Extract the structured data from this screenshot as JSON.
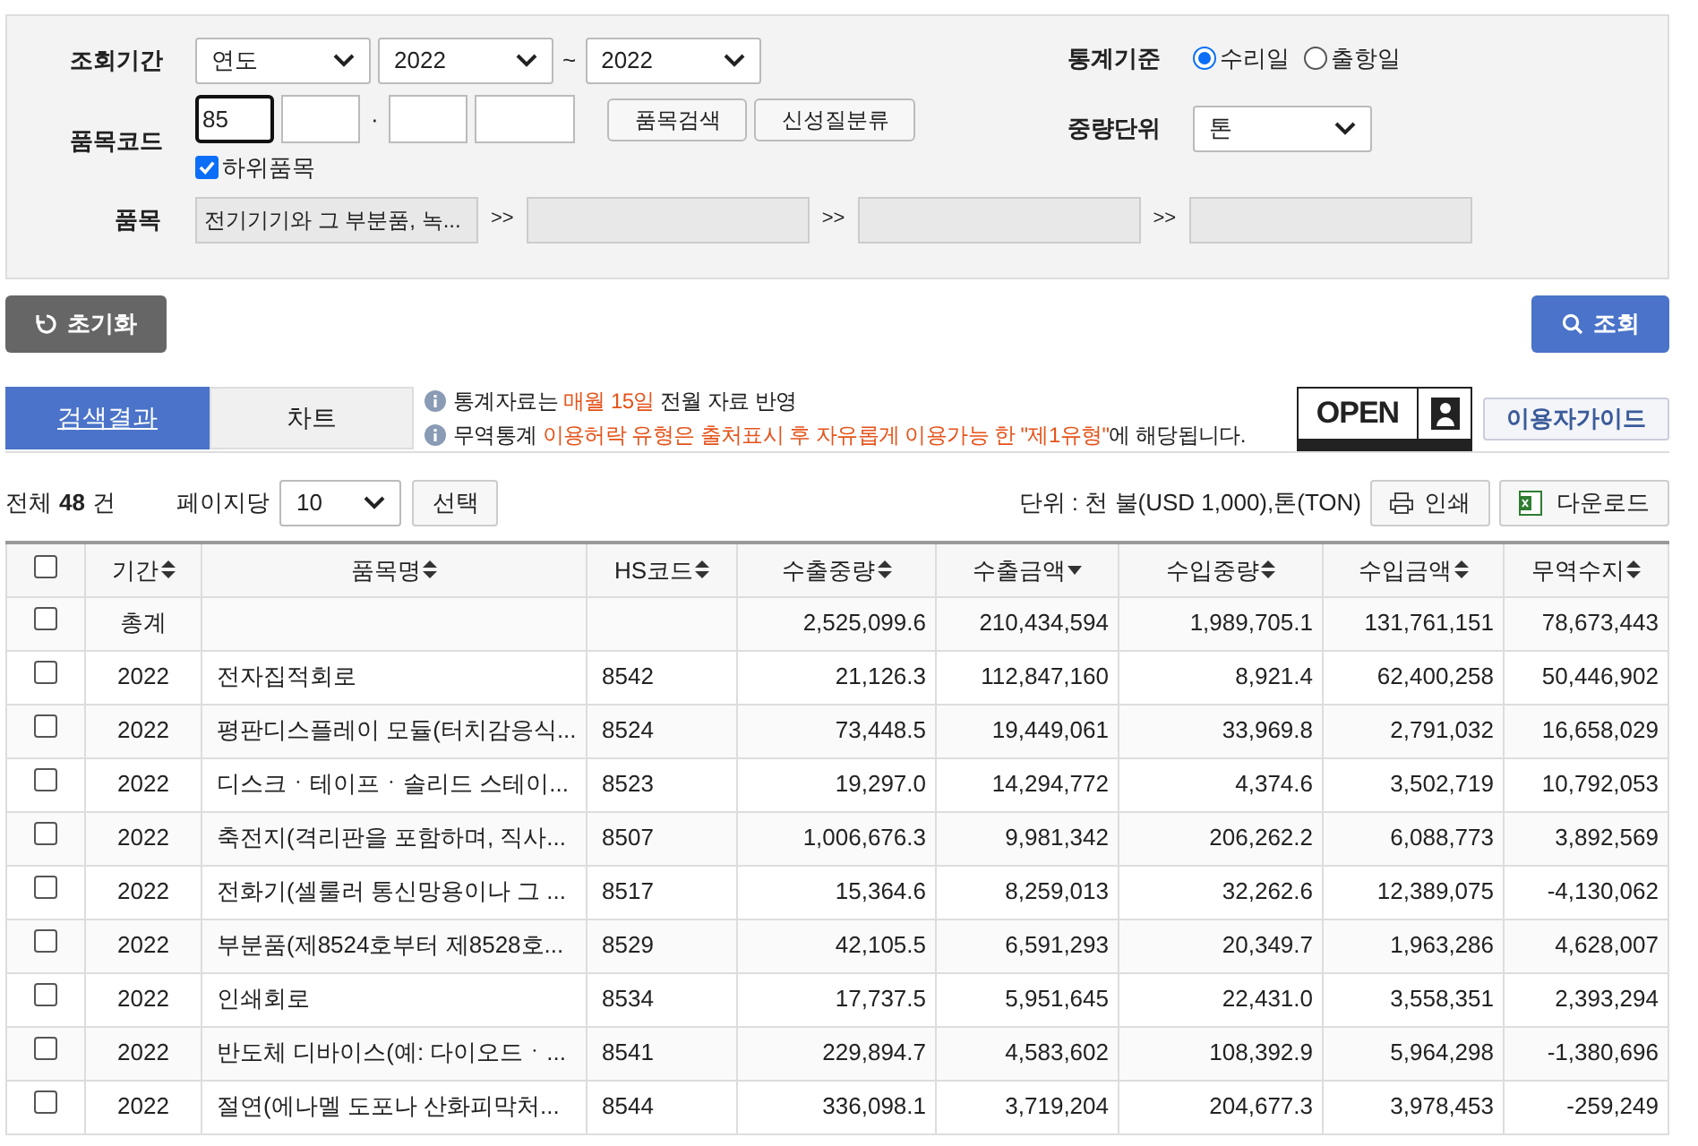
{
  "filter": {
    "period": {
      "label": "조회기간",
      "unit": "연도",
      "from": "2022",
      "range_sep": "~",
      "to": "2022"
    },
    "item_code": {
      "label": "품목코드",
      "fields": [
        {
          "value": "85",
          "focused": true
        },
        {
          "focused": false
        },
        {
          "focused": false
        },
        {
          "focused": false
        }
      ],
      "dot": "·",
      "buttons": [
        "품목검색",
        "신성질분류"
      ],
      "sub_items": {
        "label": "하위품목",
        "checked": true
      }
    },
    "item_path": {
      "label": "품목",
      "levels": [
        {
          "kind": "filled",
          "value": "전기기기와 그 부분품, 녹..."
        },
        {
          "kind": "empty"
        },
        {
          "kind": "empty"
        },
        {
          "kind": "empty"
        }
      ],
      "separators": [
        ">>",
        ">>",
        ">>"
      ]
    },
    "basis": {
      "label": "통계기준",
      "options": [
        {
          "label": "수리일",
          "selected": true
        },
        {
          "label": "출항일",
          "selected": false
        }
      ]
    },
    "weight_unit": {
      "label": "중량단위",
      "value": "톤"
    }
  },
  "reset_button": "초기화",
  "search_button": "조회",
  "tabs": [
    {
      "label": "검색결과",
      "selected": true
    },
    {
      "label": "차트",
      "selected": false
    }
  ],
  "notices": [
    [
      {
        "text": "통계자료는 "
      },
      {
        "text": "매월 15일",
        "highlight": true
      },
      {
        "text": " 전월 자료 반영"
      }
    ],
    [
      {
        "text": "무역통계 "
      },
      {
        "text": "이용허락 유형은 출처표시 후 자유롭게 이용가능 한 \"제1유형\"",
        "highlight": true
      },
      {
        "text": "에 해당됩니다."
      }
    ]
  ],
  "license_badge": "OPEN",
  "guide_button": "이용자가이드",
  "summary": {
    "total_label": "전체",
    "total": "48",
    "total_unit": "건",
    "per_page_label": "페이지당",
    "per_page": "10",
    "select_button": "선택",
    "unit_note": "단위 : 천 불(USD 1,000),톤(TON)",
    "print_button": "인쇄",
    "download_button": "다운로드"
  },
  "table": {
    "header_checked": false,
    "columns": [
      {
        "label": "기간",
        "sorted": false
      },
      {
        "label": "품목명",
        "sorted": false
      },
      {
        "label": "HS코드",
        "sorted": false
      },
      {
        "label": "수출중량",
        "sorted": false
      },
      {
        "label": "수출금액",
        "sorted": true
      },
      {
        "label": "수입중량",
        "sorted": false
      },
      {
        "label": "수입금액",
        "sorted": false
      },
      {
        "label": "무역수지",
        "sorted": false
      }
    ],
    "rows": [
      {
        "checked": false,
        "period": "총계",
        "values": [
          "2,525,099.6",
          "210,434,594",
          "1,989,705.1",
          "131,761,151",
          "78,673,443"
        ]
      },
      {
        "checked": false,
        "period": "2022",
        "name": "전자집적회로",
        "hs": "8542",
        "values": [
          "21,126.3",
          "112,847,160",
          "8,921.4",
          "62,400,258",
          "50,446,902"
        ]
      },
      {
        "checked": false,
        "period": "2022",
        "name": "평판디스플레이 모듈(터치감응식...",
        "hs": "8524",
        "values": [
          "73,448.5",
          "19,449,061",
          "33,969.8",
          "2,791,032",
          "16,658,029"
        ]
      },
      {
        "checked": false,
        "period": "2022",
        "name": "디스크ㆍ테이프ㆍ솔리드 스테이...",
        "hs": "8523",
        "values": [
          "19,297.0",
          "14,294,772",
          "4,374.6",
          "3,502,719",
          "10,792,053"
        ]
      },
      {
        "checked": false,
        "period": "2022",
        "name": "축전지(격리판을 포함하며, 직사...",
        "hs": "8507",
        "values": [
          "1,006,676.3",
          "9,981,342",
          "206,262.2",
          "6,088,773",
          "3,892,569"
        ]
      },
      {
        "checked": false,
        "period": "2022",
        "name": "전화기(셀룰러 통신망용이나 그 ...",
        "hs": "8517",
        "values": [
          "15,364.6",
          "8,259,013",
          "32,262.6",
          "12,389,075",
          "-4,130,062"
        ]
      },
      {
        "checked": false,
        "period": "2022",
        "name": "부분품(제8524호부터 제8528호...",
        "hs": "8529",
        "values": [
          "42,105.5",
          "6,591,293",
          "20,349.7",
          "1,963,286",
          "4,628,007"
        ]
      },
      {
        "checked": false,
        "period": "2022",
        "name": "인쇄회로",
        "hs": "8534",
        "values": [
          "17,737.5",
          "5,951,645",
          "22,431.0",
          "3,558,351",
          "2,393,294"
        ]
      },
      {
        "checked": false,
        "period": "2022",
        "name": "반도체 디바이스(예: 다이오드ㆍ...",
        "hs": "8541",
        "values": [
          "229,894.7",
          "4,583,602",
          "108,392.9",
          "5,964,298",
          "-1,380,696"
        ]
      },
      {
        "checked": false,
        "period": "2022",
        "name": "절연(에나멜 도포나 산화피막처...",
        "hs": "8544",
        "values": [
          "336,098.1",
          "3,719,204",
          "204,677.3",
          "3,978,453",
          "-259,249"
        ]
      }
    ]
  }
}
